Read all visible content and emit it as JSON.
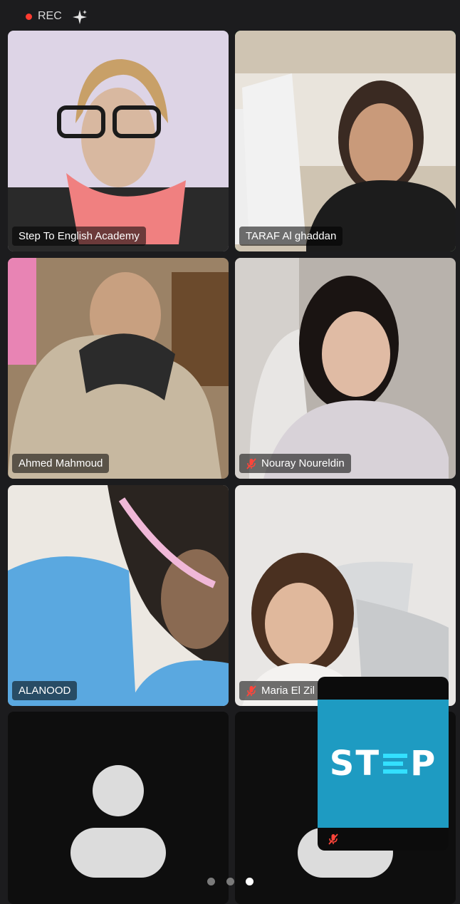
{
  "header": {
    "rec_label": "REC"
  },
  "tiles": [
    {
      "name": "Step To English Academy",
      "muted": false,
      "active": false
    },
    {
      "name": "TARAF Al ghaddan",
      "muted": false,
      "active": true
    },
    {
      "name": "Ahmed Mahmoud",
      "muted": false,
      "active": false
    },
    {
      "name": "Nouray Noureldin",
      "muted": true,
      "active": false
    },
    {
      "name": "ALANOOD",
      "muted": false,
      "active": false
    },
    {
      "name": "Maria El Zil",
      "muted": true,
      "active": false
    }
  ],
  "share": {
    "logo_left": "ST",
    "logo_right": "P"
  },
  "pagination": {
    "pages": 3,
    "current": 3
  },
  "colors": {
    "active_border": "#34c759",
    "rec_dot": "#ff3b30",
    "logo_bg": "#1e9bc2"
  }
}
